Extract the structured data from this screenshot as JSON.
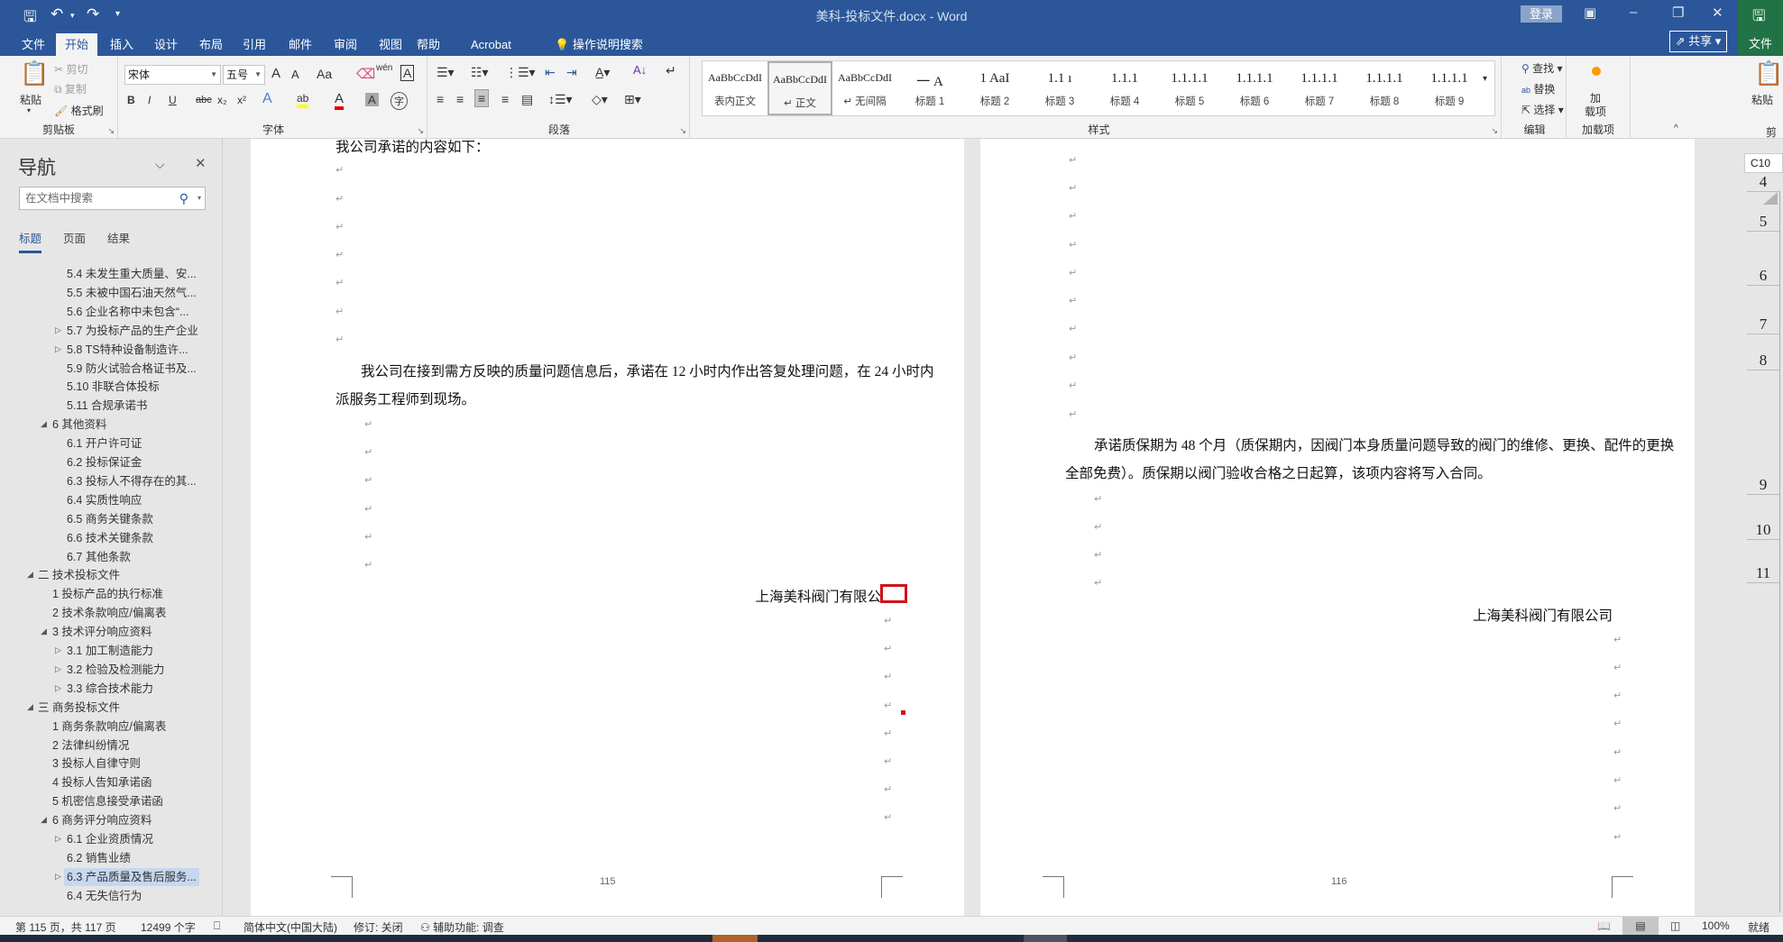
{
  "title_bar": {
    "document_title": "美科-投标文件.docx  -  Word",
    "login_label": "登录",
    "icons": [
      "save-icon",
      "undo-icon",
      "redo-icon",
      "customize-qat-icon",
      "ribbon-display-icon",
      "minimize-icon",
      "restore-icon",
      "close-icon"
    ]
  },
  "tabs": [
    "文件",
    "开始",
    "插入",
    "设计",
    "布局",
    "引用",
    "邮件",
    "审阅",
    "视图",
    "帮助",
    "Acrobat"
  ],
  "active_tab": "开始",
  "tell_me": "操作说明搜索",
  "share_label": "共享",
  "right_window": {
    "file_tab": "文件",
    "paste_label": "粘贴",
    "group_label": "剪",
    "cell_ref": "C10",
    "row_numbers": [
      "4",
      "5",
      "6",
      "7",
      "8",
      "9",
      "10",
      "11"
    ]
  },
  "ribbon": {
    "clipboard": {
      "label": "剪贴板",
      "paste": "粘贴",
      "cut": "剪切",
      "copy": "复制",
      "format_painter": "格式刷"
    },
    "font": {
      "label": "字体",
      "font_name": "宋体",
      "font_size": "五号",
      "grow": "A",
      "shrink": "A",
      "change_case": "Aa",
      "bold": "B",
      "italic": "I",
      "underline": "U",
      "strike": "abc",
      "subscript": "x₂",
      "superscript": "x²",
      "phonetic": "wén",
      "border_char": "A",
      "effects": "A",
      "char_shading": "A",
      "enclose": "字",
      "highlight_color": "#ffff00",
      "font_color": "#e00000"
    },
    "paragraph": {
      "label": "段落"
    },
    "styles": {
      "label": "样式",
      "items": [
        {
          "preview": "AaBbCcDdI",
          "label": "表内正文"
        },
        {
          "preview": "AaBbCcDdI",
          "label": "↵ 正文",
          "selected": true
        },
        {
          "preview": "AaBbCcDdI",
          "label": "↵ 无间隔"
        },
        {
          "preview": "一  A",
          "label": "标题 1"
        },
        {
          "preview": "1  AaI",
          "label": "标题 2"
        },
        {
          "preview": "1.1  ı",
          "label": "标题 3"
        },
        {
          "preview": "1.1.1",
          "label": "标题 4"
        },
        {
          "preview": "1.1.1.1",
          "label": "标题 5"
        },
        {
          "preview": "1.1.1.1",
          "label": "标题 6"
        },
        {
          "preview": "1.1.1.1",
          "label": "标题 7"
        },
        {
          "preview": "1.1.1.1",
          "label": "标题 8"
        },
        {
          "preview": "1.1.1.1",
          "label": "标题 9"
        }
      ]
    },
    "editing": {
      "label": "编辑",
      "find": "查找",
      "replace": "替换",
      "select": "选择"
    },
    "addins": {
      "label": "加载项",
      "button": "加\n载项"
    }
  },
  "nav": {
    "title": "导航",
    "search_placeholder": "在文档中搜索",
    "tabs": [
      "标题",
      "页面",
      "结果"
    ],
    "active_tab": "标题",
    "items": [
      {
        "label": "5.4 未发生重大质量、安...",
        "level": 3,
        "toggle": ""
      },
      {
        "label": "5.5 未被中国石油天然气...",
        "level": 3,
        "toggle": ""
      },
      {
        "label": "5.6 企业名称中未包含“...",
        "level": 3,
        "toggle": ""
      },
      {
        "label": "5.7 为投标产品的生产企业",
        "level": 3,
        "toggle": "collapsed"
      },
      {
        "label": "5.8 TS特种设备制造许...",
        "level": 3,
        "toggle": "collapsed"
      },
      {
        "label": "5.9 防火试验合格证书及...",
        "level": 3,
        "toggle": ""
      },
      {
        "label": "5.10 非联合体投标",
        "level": 3,
        "toggle": ""
      },
      {
        "label": "5.11 合规承诺书",
        "level": 3,
        "toggle": ""
      },
      {
        "label": "6 其他资料",
        "level": 2,
        "toggle": "expanded"
      },
      {
        "label": "6.1 开户许可证",
        "level": 3,
        "toggle": ""
      },
      {
        "label": "6.2 投标保证金",
        "level": 3,
        "toggle": ""
      },
      {
        "label": "6.3 投标人不得存在的其...",
        "level": 3,
        "toggle": ""
      },
      {
        "label": "6.4 实质性响应",
        "level": 3,
        "toggle": ""
      },
      {
        "label": "6.5 商务关键条款",
        "level": 3,
        "toggle": ""
      },
      {
        "label": "6.6 技术关键条款",
        "level": 3,
        "toggle": ""
      },
      {
        "label": "6.7 其他条款",
        "level": 3,
        "toggle": ""
      },
      {
        "label": "二 技术投标文件",
        "level": 1,
        "toggle": "expanded"
      },
      {
        "label": "1 投标产品的执行标准",
        "level": 2,
        "toggle": ""
      },
      {
        "label": "2 技术条款响应/偏离表",
        "level": 2,
        "toggle": ""
      },
      {
        "label": "3 技术评分响应资料",
        "level": 2,
        "toggle": "expanded"
      },
      {
        "label": "3.1 加工制造能力",
        "level": 3,
        "toggle": "collapsed"
      },
      {
        "label": "3.2 检验及检测能力",
        "level": 3,
        "toggle": "collapsed"
      },
      {
        "label": "3.3 综合技术能力",
        "level": 3,
        "toggle": "collapsed"
      },
      {
        "label": "三 商务投标文件",
        "level": 1,
        "toggle": "expanded"
      },
      {
        "label": "1 商务条款响应/偏离表",
        "level": 2,
        "toggle": ""
      },
      {
        "label": "2 法律纠纷情况",
        "level": 2,
        "toggle": ""
      },
      {
        "label": "3 投标人自律守则",
        "level": 2,
        "toggle": ""
      },
      {
        "label": "4 投标人告知承诺函",
        "level": 2,
        "toggle": ""
      },
      {
        "label": "5 机密信息接受承诺函",
        "level": 2,
        "toggle": ""
      },
      {
        "label": "6 商务评分响应资料",
        "level": 2,
        "toggle": "expanded"
      },
      {
        "label": "6.1 企业资质情况",
        "level": 3,
        "toggle": "collapsed"
      },
      {
        "label": "6.2 销售业绩",
        "level": 3,
        "toggle": ""
      },
      {
        "label": "6.3 产品质量及售后服务...",
        "level": 3,
        "toggle": "collapsed",
        "selected": true
      },
      {
        "label": "6.4 无失信行为",
        "level": 3,
        "toggle": ""
      }
    ]
  },
  "pages": {
    "left": {
      "top_line": "我公司承诺的内容如下：",
      "para_line1": "我公司在接到需方反映的质量问题信息后，承诺在 12 小时内作出答复处理问题，在 24 小时内",
      "para_line2": "派服务工程师到现场。",
      "signature": "上海美科阀门有限公",
      "page_number": "115"
    },
    "right": {
      "para_line1": "承诺质保期为 48 个月（质保期内，因阀门本身质量问题导致的阀门的维修、更换、配件的更换",
      "para_line2": "全部免费）。质保期以阀门验收合格之日起算，该项内容将写入合同。",
      "signature": "上海美科阀门有限公司",
      "page_number": "116"
    },
    "paragraph_mark": "↵",
    "highlight_color": "#d0121b"
  },
  "status_bar": {
    "page_info": "第 115 页，共 117 页",
    "word_count": "12499 个字",
    "language": "简体中文(中国大陆)",
    "track_changes": "修订: 关闭",
    "accessibility": "辅助功能: 调查",
    "zoom": "100%",
    "ready": "就绪"
  }
}
